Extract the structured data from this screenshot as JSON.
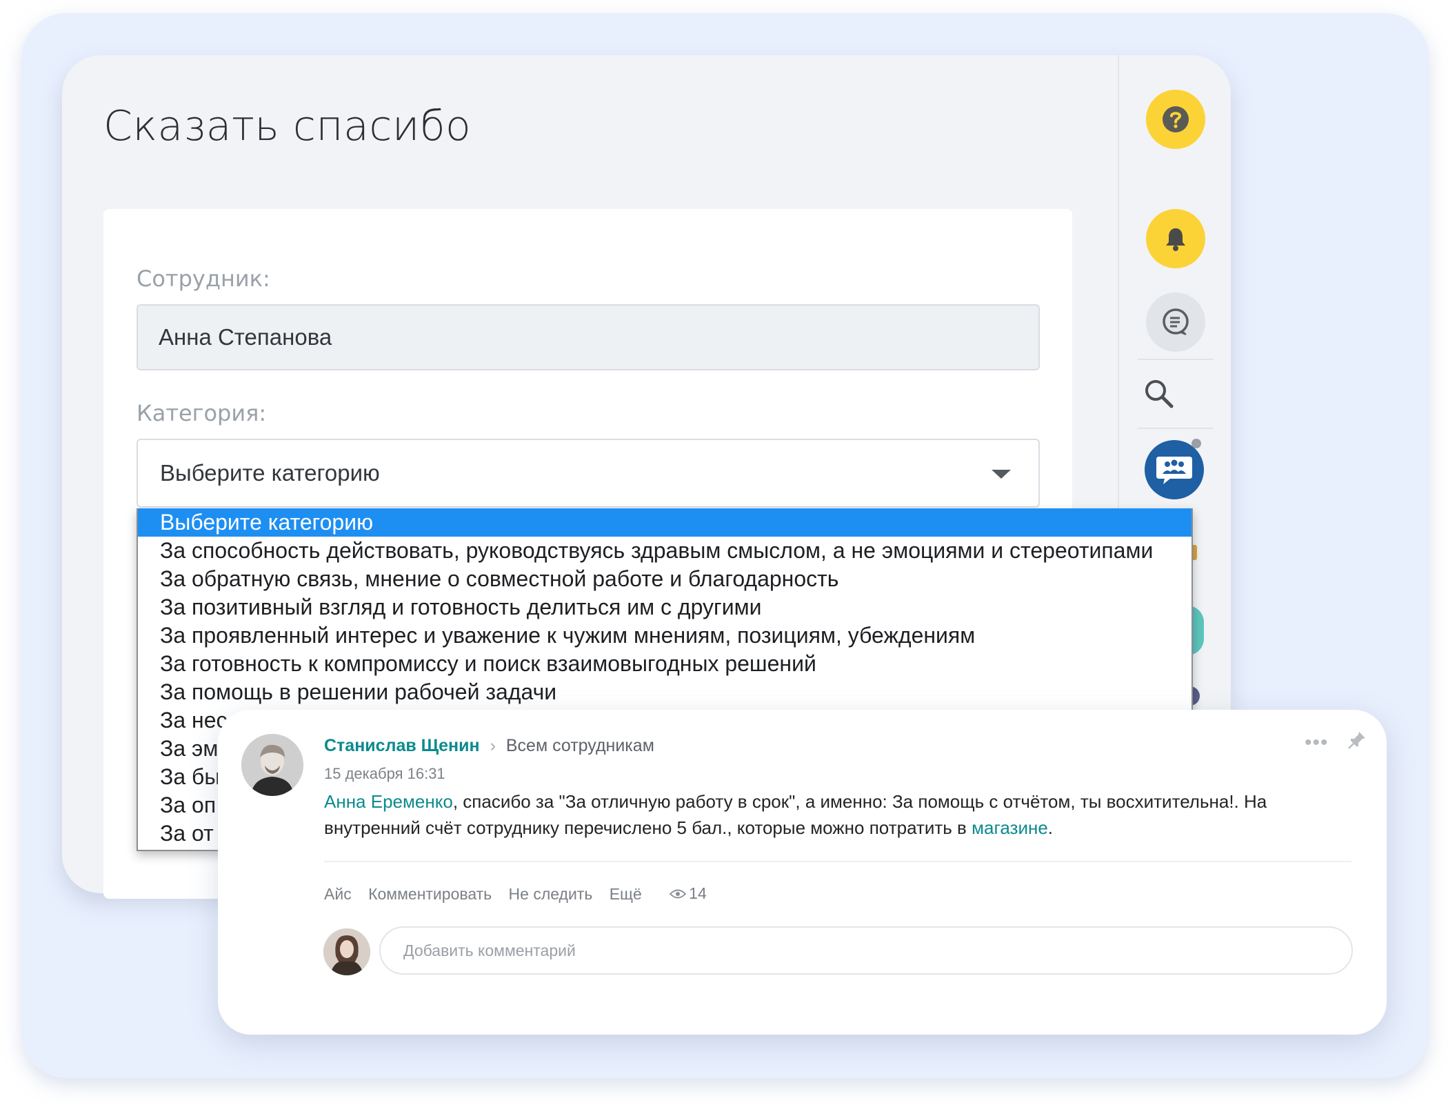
{
  "form": {
    "title": "Сказать спасибо",
    "employee_label": "Сотрудник:",
    "employee_value": "Анна Степанова",
    "category_label": "Категория:",
    "category_value": "Выберите категорию"
  },
  "dropdown": {
    "options": [
      "Выберите категорию",
      "За способность действовать, руководствуясь здравым смыслом, а не эмоциями и стереотипами",
      "За обратную связь, мнение о совместной работе и благодарность",
      "За позитивный взгляд и готовность делиться им с другими",
      "За проявленный интерес и уважение к чужим мнениям, позициям, убеждениям",
      "За готовность к компромиссу и поиск взаимовыгодных решений",
      "За помощь в решении рабочей задачи",
      "За нес",
      "За эм",
      "За бы",
      "За оп",
      "За от"
    ]
  },
  "rail": {
    "help_icon": "question-icon",
    "notifications_icon": "bell-icon",
    "chat_icon": "chat-list-icon",
    "search_icon": "search-icon",
    "group_chat_icon": "group-chat-icon",
    "help_color": "#fcd337"
  },
  "post": {
    "author": "Станислав Щенин",
    "audience": "Всем сотрудникам",
    "timestamp": "15 декабря 16:31",
    "mention": "Анна Еременко",
    "text_1": ", спасибо за \"За отличную работу в срок\", а именно: За помощь с отчётом, ты восхитительна!. На внутренний счёт сотруднику перечислено 5 бал., которые можно потратить в ",
    "shop_link": "магазине",
    "text_2": ".",
    "actions": [
      "Айс",
      "Комментировать",
      "Не следить",
      "Ещё"
    ],
    "views": "14",
    "comment_placeholder": "Добавить комментарий",
    "accent_color": "#0b8a8e"
  }
}
